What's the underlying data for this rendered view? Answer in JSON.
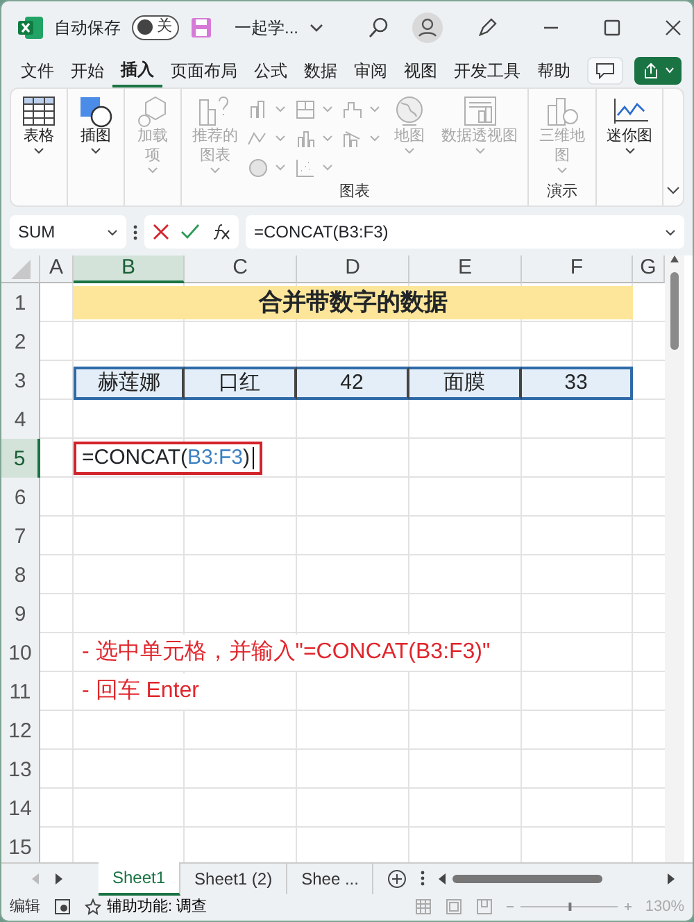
{
  "title_bar": {
    "autosave_label": "自动保存",
    "autosave_toggle": {
      "label": "关",
      "on": false
    },
    "doc_title": "一起学..."
  },
  "menu_tabs": [
    {
      "label": "文件",
      "selected": false
    },
    {
      "label": "开始",
      "selected": false
    },
    {
      "label": "插入",
      "selected": true
    },
    {
      "label": "页面布局",
      "selected": false
    },
    {
      "label": "公式",
      "selected": false
    },
    {
      "label": "数据",
      "selected": false
    },
    {
      "label": "审阅",
      "selected": false
    },
    {
      "label": "视图",
      "selected": false
    },
    {
      "label": "开发工具",
      "selected": false
    },
    {
      "label": "帮助",
      "selected": false
    }
  ],
  "ribbon": {
    "groups": [
      {
        "buttons": [
          {
            "kind": "table",
            "label": "表格",
            "disabled": false
          }
        ]
      },
      {
        "buttons": [
          {
            "kind": "shapes",
            "label": "插图",
            "disabled": false
          }
        ]
      },
      {
        "buttons": [
          {
            "kind": "addin",
            "label": "加载项",
            "disabled": true
          }
        ]
      },
      {
        "label": "图表",
        "buttons": [
          {
            "kind": "recommend",
            "label": "推荐的图表",
            "disabled": true
          },
          {
            "kind": "minicharts",
            "disabled": true
          },
          {
            "kind": "map",
            "label": "地图",
            "disabled": true
          },
          {
            "kind": "pivot",
            "label": "数据透视图",
            "disabled": true
          }
        ]
      },
      {
        "label": "演示",
        "buttons": [
          {
            "kind": "map3d",
            "label": "三维地图",
            "disabled": true
          }
        ]
      },
      {
        "buttons": [
          {
            "kind": "sparkline",
            "label": "迷你图",
            "disabled": false
          }
        ]
      }
    ]
  },
  "formula_bar": {
    "name_box": "SUM",
    "formula": "=CONCAT(B3:F3)"
  },
  "columns": [
    {
      "label": "A",
      "selected": false
    },
    {
      "label": "B",
      "selected": true
    },
    {
      "label": "C",
      "selected": false
    },
    {
      "label": "D",
      "selected": false
    },
    {
      "label": "E",
      "selected": false
    },
    {
      "label": "F",
      "selected": false
    },
    {
      "label": "G",
      "selected": false
    }
  ],
  "rows": [
    {
      "label": "1",
      "selected": false
    },
    {
      "label": "2",
      "selected": false
    },
    {
      "label": "3",
      "selected": false
    },
    {
      "label": "4",
      "selected": false
    },
    {
      "label": "5",
      "selected": true
    },
    {
      "label": "6",
      "selected": false
    },
    {
      "label": "7",
      "selected": false
    },
    {
      "label": "8",
      "selected": false
    },
    {
      "label": "9",
      "selected": false
    },
    {
      "label": "10",
      "selected": false
    },
    {
      "label": "11",
      "selected": false
    },
    {
      "label": "12",
      "selected": false
    },
    {
      "label": "13",
      "selected": false
    },
    {
      "label": "14",
      "selected": false
    },
    {
      "label": "15",
      "selected": false
    }
  ],
  "sheet": {
    "title": "合并带数字的数据",
    "data_row": [
      "赫莲娜",
      "口红",
      "42",
      "面膜",
      "33"
    ],
    "editing_cell": {
      "prefix": "=CONCAT(",
      "reference": "B3:F3",
      "suffix": ")"
    },
    "notes": [
      "- 选中单元格，并输入\"=CONCAT(B3:F3)\"",
      "- 回车 Enter"
    ]
  },
  "sheet_tabs": [
    {
      "label": "Sheet1",
      "selected": true
    },
    {
      "label": "Sheet1 (2)",
      "selected": false
    },
    {
      "label": "Shee ...",
      "selected": false
    }
  ],
  "status_bar": {
    "mode": "编辑",
    "accessibility": "辅助功能: 调查",
    "zoom_slider": {
      "level": 0.51
    },
    "zoom": "130%"
  }
}
